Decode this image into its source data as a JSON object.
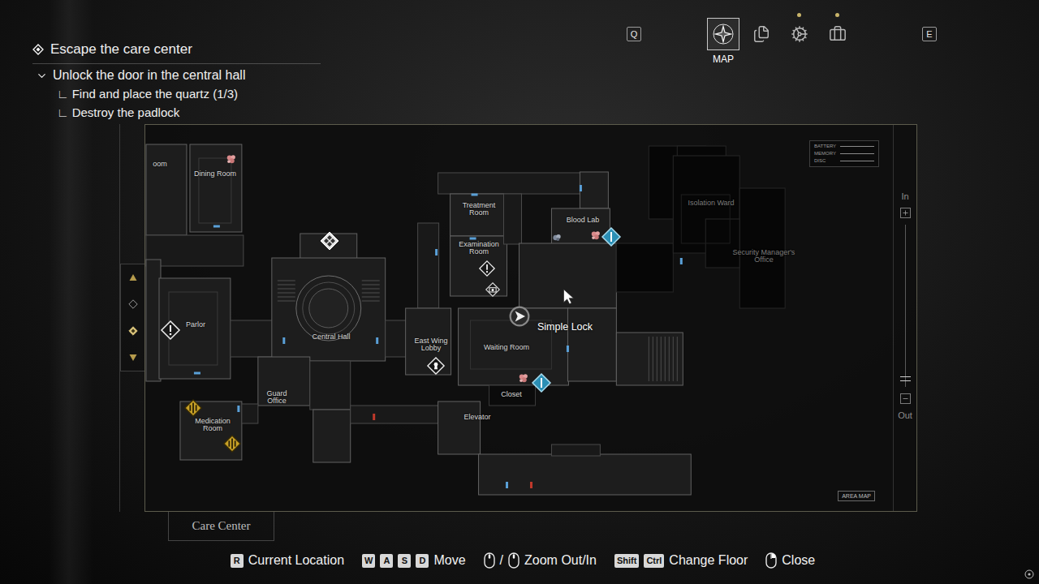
{
  "objective": {
    "title": "Escape the care center",
    "task": {
      "label": "Unlock the door in the central hall",
      "expanded": true
    },
    "subtasks": [
      {
        "marker": "∟",
        "label": "Find and place the quartz (1/3)"
      },
      {
        "marker": "∟",
        "label": "Destroy the padlock"
      }
    ]
  },
  "tabs": {
    "prev_key": "Q",
    "next_key": "E",
    "items": [
      {
        "kind": "map",
        "label": "MAP",
        "selected": true,
        "notify": false
      },
      {
        "kind": "files",
        "selected": false,
        "notify": false
      },
      {
        "kind": "upgrades",
        "selected": false,
        "notify": true
      },
      {
        "kind": "items",
        "selected": false,
        "notify": true
      }
    ]
  },
  "map": {
    "rooms": [
      {
        "name": "oom",
        "explored": true
      },
      {
        "name": "Dining Room",
        "explored": true
      },
      {
        "name": "Treatment Room",
        "explored": true
      },
      {
        "name": "Examination Room",
        "explored": true
      },
      {
        "name": "Blood Lab",
        "explored": true
      },
      {
        "name": "Isolation Ward",
        "explored": false
      },
      {
        "name": "Security Manager's Office",
        "explored": false
      },
      {
        "name": "Parlor",
        "explored": true
      },
      {
        "name": "Central Hall",
        "explored": true
      },
      {
        "name": "East Wing Lobby",
        "explored": true
      },
      {
        "name": "Waiting Room",
        "explored": true
      },
      {
        "name": "Closet",
        "explored": true
      },
      {
        "name": "Guard Office",
        "explored": true
      },
      {
        "name": "Medication Room",
        "explored": true
      },
      {
        "name": "Elevator",
        "explored": true
      }
    ],
    "tooltip": "Simple Lock",
    "markers": [
      {
        "kind": "save"
      },
      {
        "kind": "alert"
      },
      {
        "kind": "alert"
      },
      {
        "kind": "device"
      },
      {
        "kind": "lock"
      },
      {
        "kind": "item"
      },
      {
        "kind": "item"
      },
      {
        "kind": "item"
      },
      {
        "kind": "loot"
      },
      {
        "kind": "objective"
      },
      {
        "kind": "objective"
      },
      {
        "kind": "hazard"
      },
      {
        "kind": "hazard"
      },
      {
        "kind": "player"
      },
      {
        "kind": "cursor"
      }
    ],
    "doors": [
      {
        "locked": false
      },
      {
        "locked": false
      },
      {
        "locked": false
      },
      {
        "locked": false
      },
      {
        "locked": false
      },
      {
        "locked": false
      },
      {
        "locked": false
      },
      {
        "locked": false
      },
      {
        "locked": false
      },
      {
        "locked": false
      },
      {
        "locked": true
      },
      {
        "locked": true
      },
      {
        "locked": false
      },
      {
        "locked": false
      }
    ],
    "legend": [
      "BATTERY",
      "MEMORY",
      "DISC"
    ],
    "badge": "AREA MAP",
    "zoom": {
      "in": "In",
      "out": "Out",
      "level": 0.05
    },
    "floors": [
      {
        "kind": "up",
        "selected": false
      },
      {
        "kind": "floor",
        "selected": false
      },
      {
        "kind": "floor",
        "selected": true
      },
      {
        "kind": "down",
        "selected": false
      }
    ]
  },
  "area": "Care Center",
  "controls": [
    {
      "kind": "keys",
      "keys": [
        "R"
      ],
      "label": "Current Location"
    },
    {
      "kind": "keys",
      "keys": [
        "W",
        "A",
        "S",
        "D"
      ],
      "label": "Move"
    },
    {
      "kind": "wheel",
      "separator": "/",
      "label": "Zoom Out/In"
    },
    {
      "kind": "keys",
      "keys": [
        "Shift",
        "Ctrl"
      ],
      "label": "Change Floor"
    },
    {
      "kind": "mouse",
      "label": "Close"
    }
  ]
}
